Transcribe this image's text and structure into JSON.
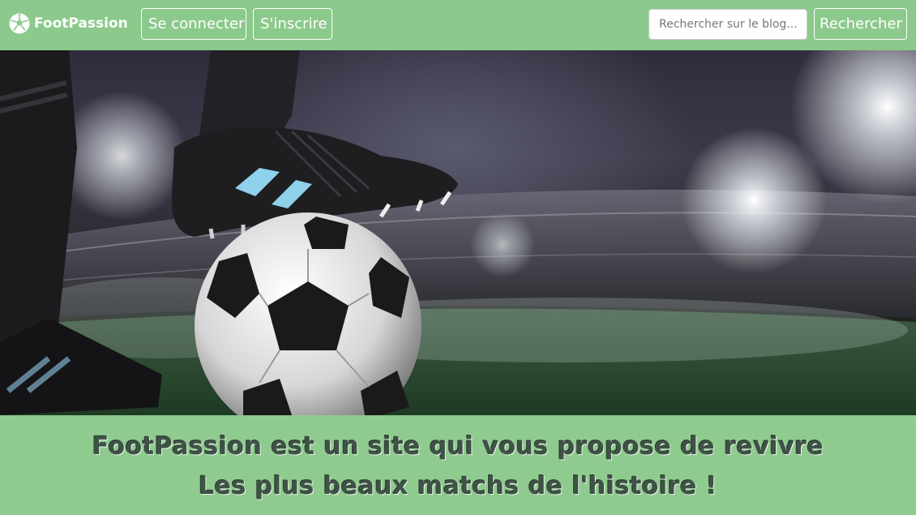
{
  "navbar": {
    "brand": "FootPassion",
    "brand_icon": "soccer-ball-icon",
    "login_label": "Se connecter",
    "register_label": "S'inscrire",
    "search_placeholder": "Rechercher sur le blog...",
    "search_button_label": "Rechercher",
    "background_color": "#8cc98c"
  },
  "hero": {
    "image": "soccer-player-foot-on-ball-stadium"
  },
  "tagline": {
    "line1": "FootPassion est un site qui vous propose de revivre",
    "line2": "Les plus beaux matchs de l'histoire !",
    "background_color": "#8fcb8f"
  }
}
